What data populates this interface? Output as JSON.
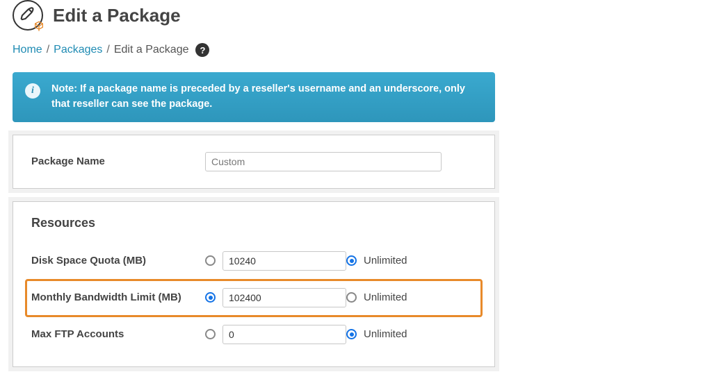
{
  "header": {
    "title": "Edit a Package"
  },
  "breadcrumb": {
    "home": "Home",
    "packages": "Packages",
    "current": "Edit a Package"
  },
  "notice": {
    "text": "Note: If a package name is preceded by a reseller's username and an underscore, only that reseller can see the package."
  },
  "package": {
    "name_label": "Package Name",
    "name_value": "Custom"
  },
  "resources": {
    "title": "Resources",
    "unlimited_label": "Unlimited",
    "rows": [
      {
        "label": "Disk Space Quota (MB)",
        "value": "10240",
        "selected": "unlimited",
        "highlight": false
      },
      {
        "label": "Monthly Bandwidth Limit (MB)",
        "value": "102400",
        "selected": "value",
        "highlight": true
      },
      {
        "label": "Max FTP Accounts",
        "value": "0",
        "selected": "unlimited",
        "highlight": false
      }
    ]
  }
}
